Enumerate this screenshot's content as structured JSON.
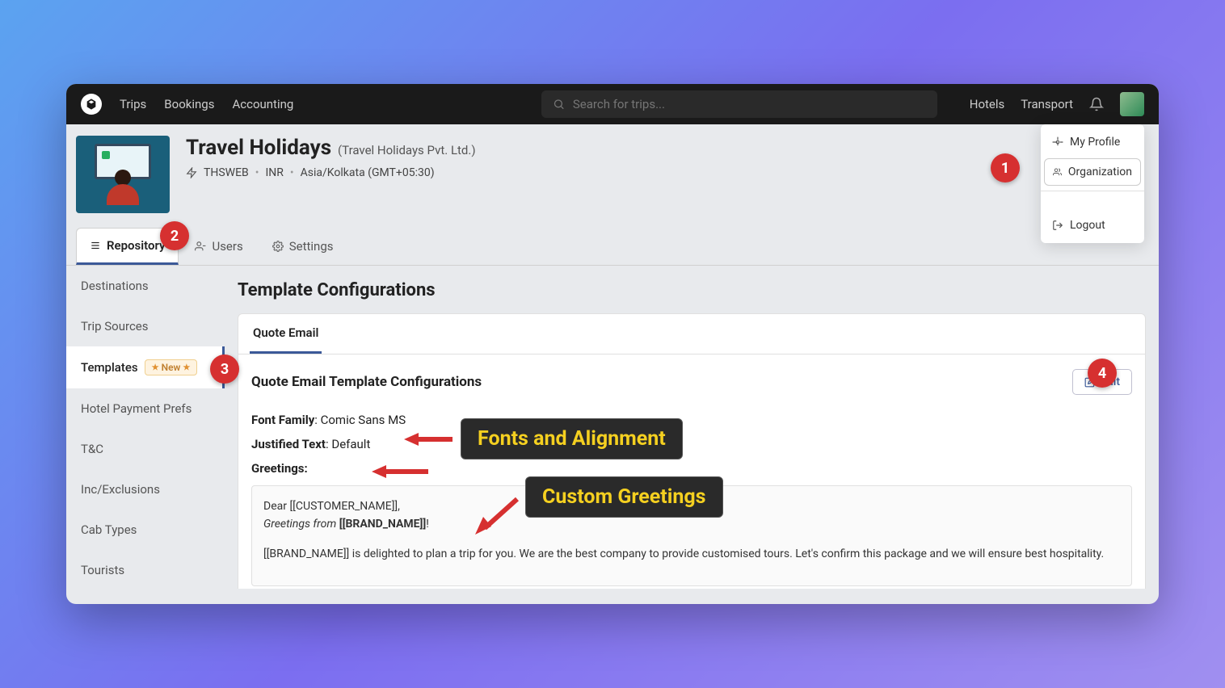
{
  "nav": {
    "trips": "Trips",
    "bookings": "Bookings",
    "accounting": "Accounting",
    "hotels": "Hotels",
    "transport": "Transport"
  },
  "search": {
    "placeholder": "Search for trips..."
  },
  "dropdown": {
    "profile": "My Profile",
    "organization": "Organization",
    "logout": "Logout"
  },
  "org": {
    "name": "Travel Holidays",
    "legal": "(Travel Holidays Pvt. Ltd.)",
    "code": "THSWEB",
    "currency": "INR",
    "tz": "Asia/Kolkata (GMT+05:30)"
  },
  "tabs": {
    "repository": "Repository",
    "users": "Users",
    "settings": "Settings"
  },
  "sidebar": {
    "destinations": "Destinations",
    "trip_sources": "Trip Sources",
    "templates": "Templates",
    "new_badge": "New",
    "hotel_prefs": "Hotel Payment Prefs",
    "tc": "T&C",
    "inc_excl": "Inc/Exclusions",
    "cab_types": "Cab Types",
    "tourists": "Tourists"
  },
  "panel": {
    "title": "Template Configurations",
    "tab_quote": "Quote Email",
    "section_title": "Quote Email Template Configurations",
    "edit": "Edit",
    "font_family_label": "Font Family",
    "font_family_value": ": Comic Sans MS",
    "justified_label": "Justified Text",
    "justified_value": ": Default",
    "greetings_label": "Greetings:",
    "greetings_line1a": "Dear ",
    "greetings_line1b": "[[CUSTOMER_NAME]],",
    "greetings_line2a": "Greetings from ",
    "greetings_line2b": "[[BRAND_NAME]]",
    "greetings_line2c": "!",
    "greetings_body": "[[BRAND_NAME]] is delighted to plan a trip for you. We are the best company to provide customised tours. Let's confirm this package and we will ensure best hospitality."
  },
  "callouts": {
    "fonts": "Fonts and Alignment",
    "greetings": "Custom Greetings"
  },
  "steps": {
    "s1": "1",
    "s2": "2",
    "s3": "3",
    "s4": "4"
  }
}
